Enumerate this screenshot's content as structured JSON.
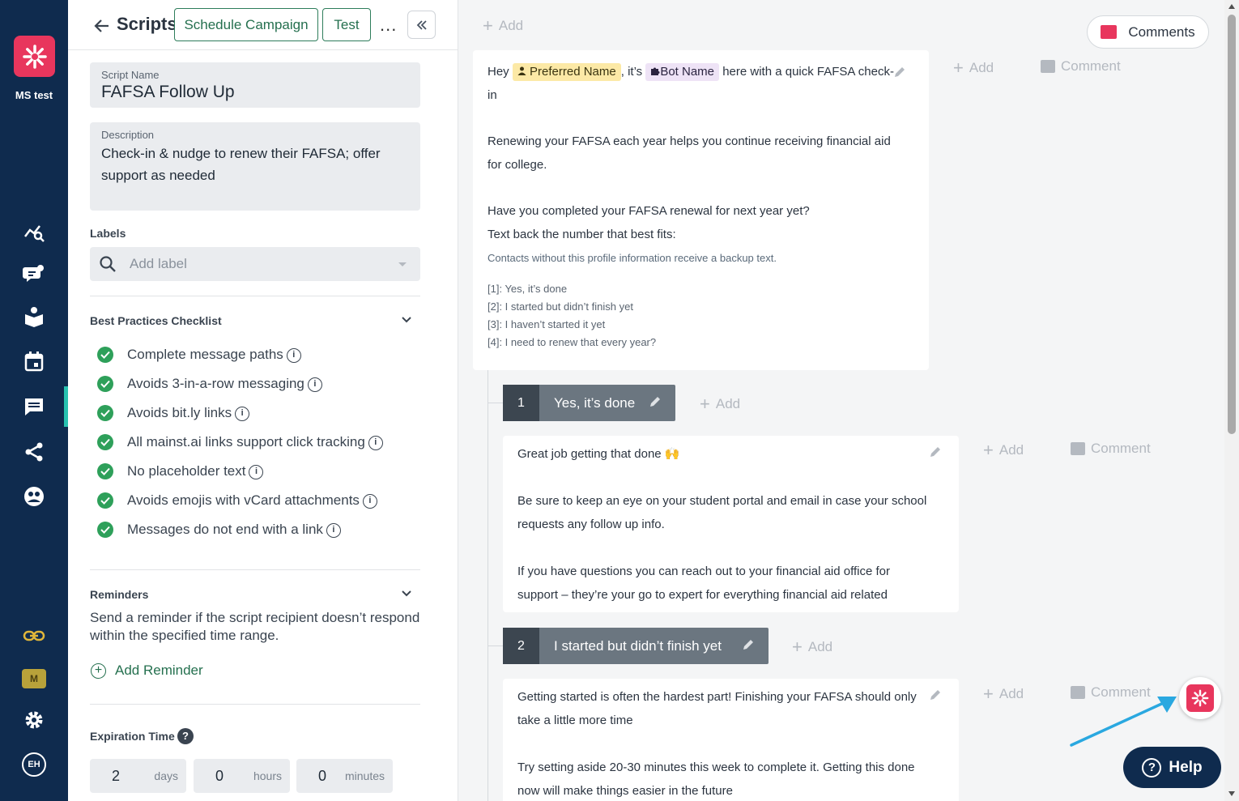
{
  "nav": {
    "org_name": "MS test",
    "badge": "M",
    "avatar_initials": "EH",
    "items": [
      "analytics-icon",
      "chat-bot-icon",
      "knowledge-icon",
      "calendar-icon",
      "messages-icon",
      "share-icon",
      "support-icon",
      "link-icon",
      "settings-icon"
    ]
  },
  "header": {
    "title": "Scripts",
    "schedule_label": "Schedule Campaign",
    "test_label": "Test",
    "more_label": "..."
  },
  "script": {
    "name_label": "Script Name",
    "name": "FAFSA Follow Up",
    "desc_label": "Description",
    "desc": "Check-in & nudge to renew their FAFSA; offer support as needed"
  },
  "labels": {
    "title": "Labels",
    "placeholder": "Add label"
  },
  "checklist": {
    "title": "Best Practices Checklist",
    "items": [
      "Complete message paths",
      "Avoids 3-in-a-row messaging",
      "Avoids bit.ly links",
      "All mainst.ai links support click tracking",
      "No placeholder text",
      "Avoids emojis with vCard attachments",
      "Messages do not end with a link"
    ]
  },
  "reminders": {
    "title": "Reminders",
    "text": "Send a reminder if the script recipient doesn’t respond within the specified time range.",
    "add_label": "Add Reminder"
  },
  "expiration": {
    "title": "Expiration Time",
    "help": "?",
    "days": "2",
    "days_unit": "days",
    "hours": "0",
    "hours_unit": "hours",
    "minutes": "0",
    "minutes_unit": "minutes"
  },
  "canvas": {
    "add_label": "Add",
    "comment_label": "Comment",
    "comments_button": "Comments",
    "help_button": "Help",
    "root": {
      "hey": "Hey",
      "preferred_name": "Preferred Name",
      "its": ", it’s",
      "bot_name": "Bot Name",
      "line1_rest": "here with a quick FAFSA check-",
      "line1_cont": "in",
      "p2a": "Renewing your FAFSA each year helps you continue receiving financial aid",
      "p2b": "for college.",
      "p3a": "Have you completed your FAFSA renewal for next year yet?",
      "p3b": "Text back the number that best fits:",
      "backup_note": "Contacts without this profile information receive a backup text.",
      "options": [
        "[1]: Yes, it’s done",
        "[2]: I started but didn’t finish yet",
        "[3]: I haven’t started it yet",
        "[4]: I need to renew that every year?"
      ]
    },
    "branches": [
      {
        "number": "1",
        "label": "Yes, it’s done",
        "lines": [
          "Great job getting that done 🙌",
          "",
          "Be sure to keep an eye on your student portal and email in case your school",
          "requests any follow up info.",
          "",
          "If you have questions you can reach out to your financial aid office for",
          "support – they’re your go to expert for everything financial aid related"
        ]
      },
      {
        "number": "2",
        "label": "I started but didn’t finish yet",
        "lines": [
          "Getting started is often the hardest part! Finishing your FAFSA should only",
          "take a little more time",
          "",
          "Try setting aside 20-30 minutes this week to complete it. Getting this done",
          "now will make things easier in the future"
        ]
      }
    ]
  }
}
